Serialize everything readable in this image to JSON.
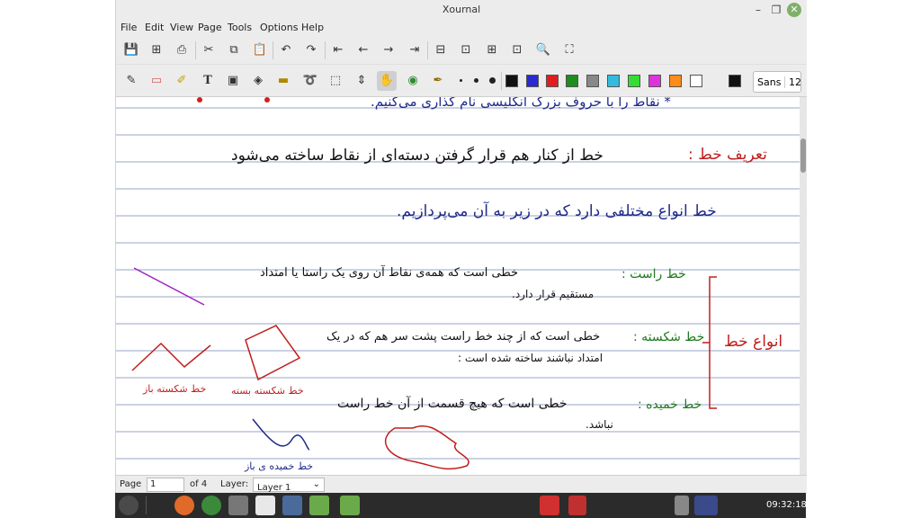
{
  "window": {
    "title": "Xournal",
    "minimize_glyph": "–",
    "maximize_glyph": "❐",
    "close_glyph": "✕"
  },
  "menu": [
    "File",
    "Edit",
    "View",
    "Page",
    "Tools",
    "Options",
    "Help"
  ],
  "toolbar1": {
    "icons": [
      "save-icon",
      "new-page-icon",
      "print-icon",
      "cut-icon",
      "copy-icon",
      "paste-icon",
      "undo-icon",
      "redo-icon",
      "first-page-icon",
      "prev-page-icon",
      "next-page-icon",
      "last-page-icon",
      "zoom-out-icon",
      "zoom-normal-icon",
      "zoom-in-icon",
      "page-width-icon",
      "search-icon",
      "fullscreen-icon"
    ],
    "glyphs": [
      "💾",
      "⊞",
      "⎙",
      "✂",
      "⧉",
      "📋",
      "↶",
      "↷",
      "⇤",
      "←",
      "→",
      "⇥",
      "⊟",
      "⊡",
      "⊞",
      "⊡",
      "🔍",
      "⛶"
    ]
  },
  "toolbar2": {
    "colors": [
      "#111111",
      "#2a2ad0",
      "#e01e1e",
      "#1e8c1e",
      "#888888",
      "#33bbdd",
      "#33dd33",
      "#dd33dd",
      "#ff8c1a",
      "#ffffff",
      "#111111"
    ],
    "font_name": "Sans",
    "font_size": "12"
  },
  "page_text": {
    "line1": "* نقاط را با حروف بزرگ انگلیسی نام گذاری می‌کنیم.",
    "def_label": "تعریف خط :",
    "def_text": "خط از کنار هم قرار گرفتن دسته‌ای از نقاط ساخته می‌شود",
    "types_intro": "خط انواع مختلفی دارد که در زیر به آن می‌پردازیم.",
    "straight_label": "خط راست :",
    "straight_text": "خطی است که همه‌ی نقاط آن روی یک راستا یا امتداد",
    "straight_text2": "مستقیم قرار دارد.",
    "broken_label": "خط شکسته :",
    "broken_text": "خطی است که از چند خط راست پشت سر هم که در یک",
    "broken_text2": "امتداد نباشند ساخته شده است :",
    "curved_label": "خط خمیده :",
    "curved_text": "خطی است که هیچ قسمت از آن خط راست",
    "curved_text2": "نباشد.",
    "types_side": "انواع خط",
    "open_broken": "خط شکسته باز",
    "closed_broken": "خط شکسته بسته",
    "open_curved": "خط خمیده ی باز"
  },
  "status": {
    "page_label": "Page",
    "page_value": "1",
    "of_label": "of 4",
    "layer_label": "Layer:",
    "layer_value": "Layer 1"
  },
  "taskbar": {
    "time": "09:32:18"
  }
}
